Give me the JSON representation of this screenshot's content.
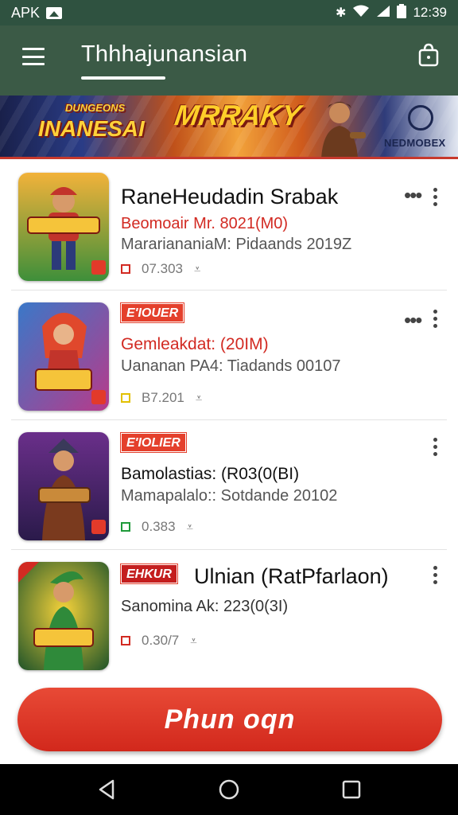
{
  "status_bar": {
    "carrier_label": "APK",
    "time": "12:39",
    "icons": [
      "bluetooth-icon",
      "wifi-icon",
      "signal-icon",
      "battery-icon"
    ]
  },
  "app_bar": {
    "title": "Thhhajunansian",
    "menu_icon": "menu-icon",
    "bag_icon": "bag-icon"
  },
  "banner": {
    "left_logo_small": "DUNGEONS",
    "left_logo": "INANESAI",
    "center_logo": "MRRAKY",
    "brand_text": "NEDMOBEX"
  },
  "apps": [
    {
      "title": "RaneHeudadin Srabak",
      "line1": "Beomoair Mr. 8021(M0)",
      "line2": "MarariananiaM: Pidaands 2019Z",
      "meta": "07.303",
      "badge": ""
    },
    {
      "title": "",
      "badge": "E'IOUER",
      "line1": "Gemleakdat: (20IM)",
      "line2": "Uananan PA4: Tiadands 00107",
      "meta": "B7.201"
    },
    {
      "title": "",
      "badge": "E'IOLIER",
      "line1": "Bamolastias: (R03(0(BI)",
      "line2": "Mamapalalo:: Sotdande 20102",
      "meta": "0.383"
    },
    {
      "title": "Ulnian (RatPfarlaon)",
      "badge": "EHKUR",
      "line1": "",
      "line2": "Sanomina Ak: 223(0(3I)",
      "meta": "0.30/7"
    }
  ],
  "cta": {
    "label": "Phun oqn"
  },
  "colors": {
    "app_bar": "#3b5a46",
    "accent_red": "#d22a22",
    "cta": "#e03a2b"
  }
}
